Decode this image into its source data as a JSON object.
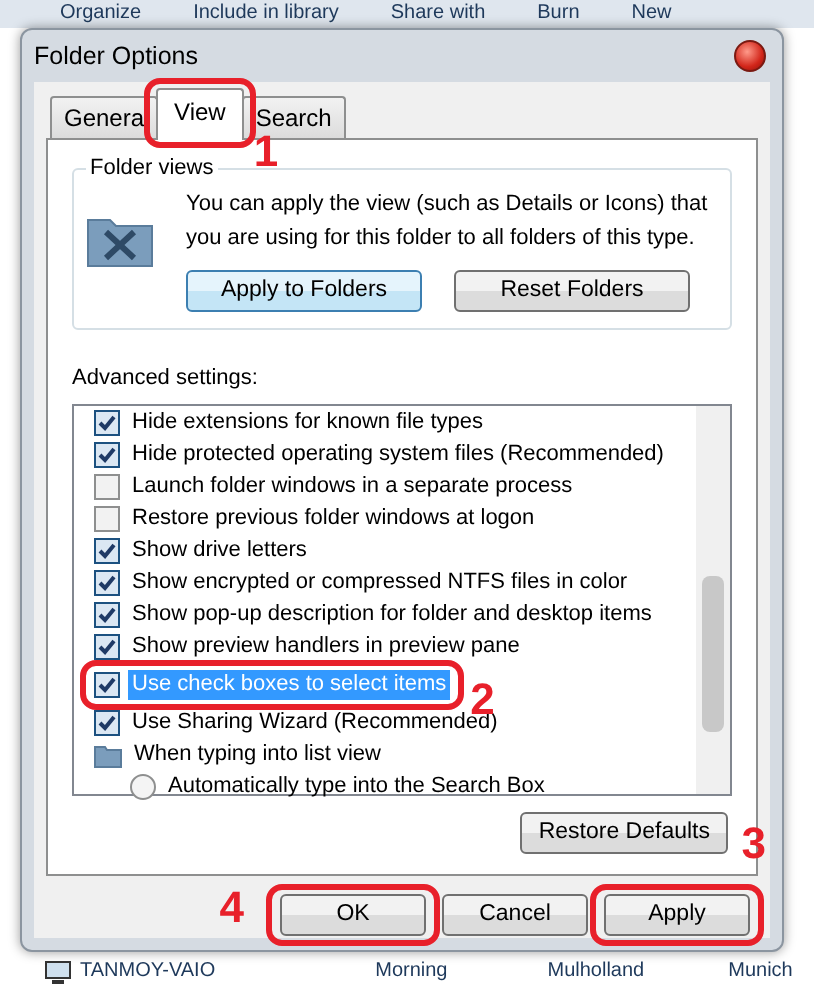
{
  "background": {
    "toolbar": [
      "Organize",
      "Include in library",
      "Share with",
      "Burn",
      "New"
    ],
    "computer_name": "TANMOY-VAIO",
    "thumbnails": [
      "Morning",
      "Mulholland",
      "Munich"
    ]
  },
  "window": {
    "title": "Folder Options"
  },
  "tabs": [
    {
      "label": "Genera",
      "selected": false
    },
    {
      "label": "View",
      "selected": true,
      "annotation": "1"
    },
    {
      "label": "Search",
      "selected": false
    }
  ],
  "folder_views": {
    "title": "Folder views",
    "text": "You can apply the view (such as Details or Icons) that you are using for this folder to all folders of this type.",
    "buttons": [
      {
        "label": "Apply to Folders",
        "default": true
      },
      {
        "label": "Reset Folders",
        "default": false
      }
    ]
  },
  "advanced": {
    "label": "Advanced settings:",
    "items": [
      {
        "kind": "checkbox",
        "label": "Hide extensions for known file types",
        "checked": true,
        "selected": false
      },
      {
        "kind": "checkbox",
        "label": "Hide protected operating system files (Recommended)",
        "checked": true,
        "selected": false
      },
      {
        "kind": "checkbox",
        "label": "Launch folder windows in a separate process",
        "checked": false,
        "selected": false
      },
      {
        "kind": "checkbox",
        "label": "Restore previous folder windows at logon",
        "checked": false,
        "selected": false
      },
      {
        "kind": "checkbox",
        "label": "Show drive letters",
        "checked": true,
        "selected": false
      },
      {
        "kind": "checkbox",
        "label": "Show encrypted or compressed NTFS files in color",
        "checked": true,
        "selected": false
      },
      {
        "kind": "checkbox",
        "label": "Show pop-up description for folder and desktop items",
        "checked": true,
        "selected": false
      },
      {
        "kind": "checkbox",
        "label": "Show preview handlers in preview pane",
        "checked": true,
        "selected": false
      },
      {
        "kind": "checkbox",
        "label": "Use check boxes to select items",
        "checked": true,
        "selected": true,
        "annotation": "2"
      },
      {
        "kind": "checkbox",
        "label": "Use Sharing Wizard (Recommended)",
        "checked": true,
        "selected": false
      },
      {
        "kind": "folder",
        "label": "When typing into list view",
        "selected": false
      },
      {
        "kind": "radio",
        "label": "Automatically type into the Search Box",
        "checked": false,
        "selected": false
      }
    ]
  },
  "restore_defaults": "Restore Defaults",
  "buttons": [
    {
      "label": "OK",
      "annotation": "4"
    },
    {
      "label": "Cancel"
    },
    {
      "label": "Apply",
      "annotation": "3"
    }
  ]
}
